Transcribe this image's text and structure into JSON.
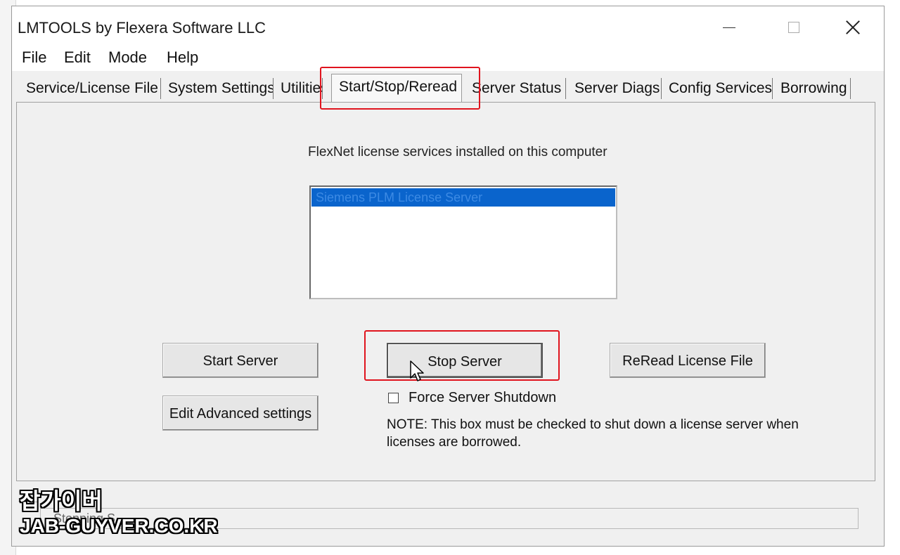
{
  "window": {
    "title": "LMTOOLS by Flexera Software LLC"
  },
  "menu": [
    "File",
    "Edit",
    "Mode",
    "Help"
  ],
  "tabs": [
    {
      "label": "Service/License File"
    },
    {
      "label": "System Settings"
    },
    {
      "label": "Utilities"
    },
    {
      "label": "Start/Stop/Reread",
      "active": true
    },
    {
      "label": "Server Status"
    },
    {
      "label": "Server Diags"
    },
    {
      "label": "Config Services"
    },
    {
      "label": "Borrowing"
    }
  ],
  "panel": {
    "services_caption": "FlexNet license services installed on this computer",
    "services": [
      "Siemens PLM License Server"
    ],
    "buttons": {
      "start": "Start Server",
      "stop": "Stop Server",
      "reread": "ReRead License File",
      "advanced": "Edit Advanced settings"
    },
    "force_shutdown": {
      "label": "Force Server Shutdown",
      "checked": false
    },
    "note": "NOTE:  This box must be checked to shut down a license server when licenses are borrowed."
  },
  "status": {
    "text": "Stopping S..."
  },
  "watermark": {
    "korean": "잡가이버",
    "site": "JAB-GUYVER.CO.KR"
  },
  "colors": {
    "highlight": "#e0141e",
    "selection": "#0a64cc"
  }
}
